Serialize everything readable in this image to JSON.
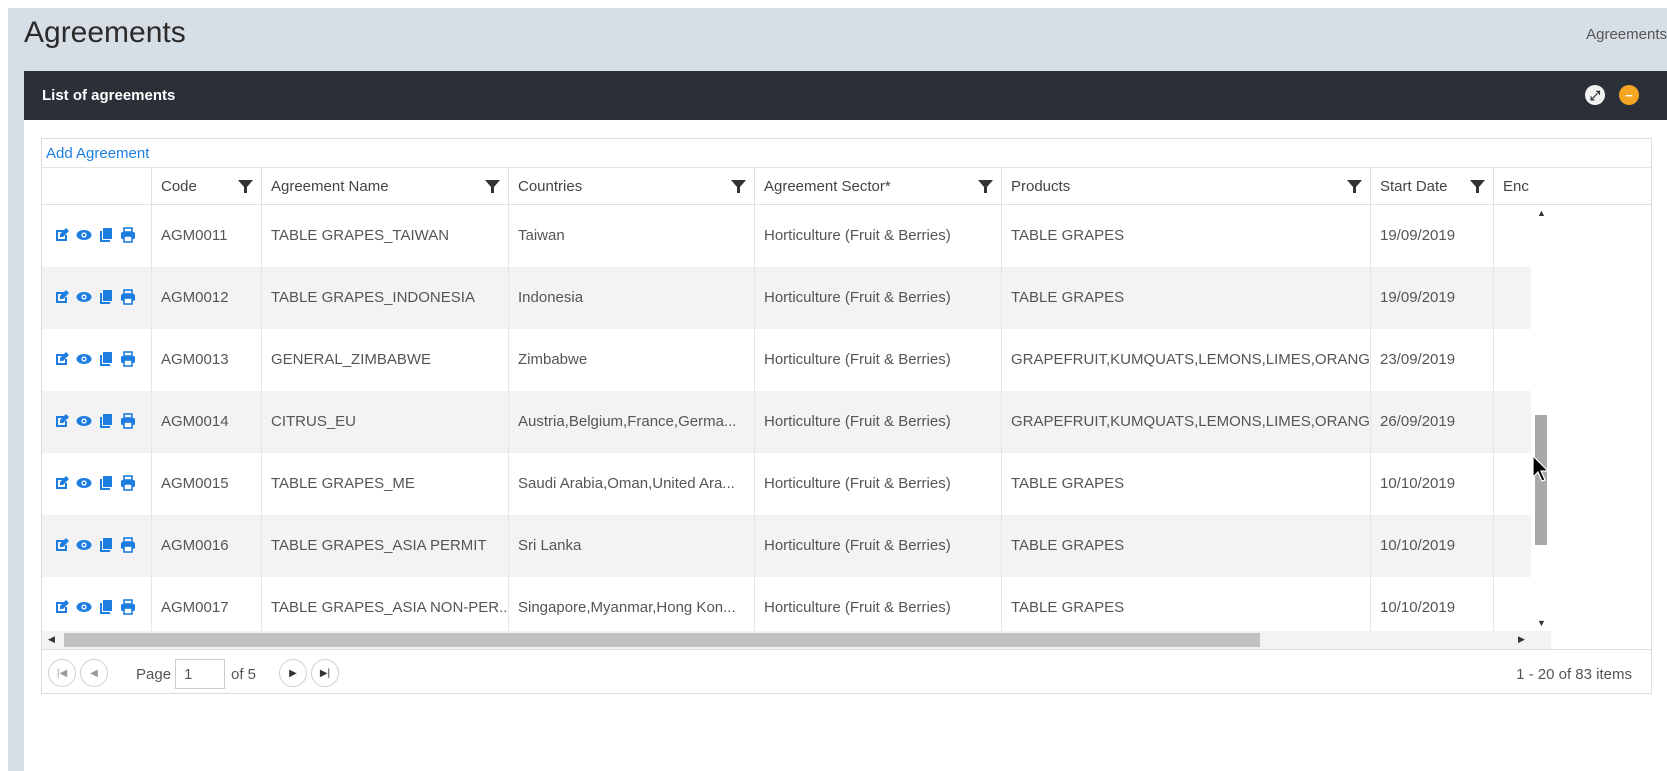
{
  "page": {
    "title": "Agreements",
    "breadcrumb": "Agreements"
  },
  "panel": {
    "title": "List of agreements"
  },
  "toolbar": {
    "add_label": "Add Agreement"
  },
  "columns": [
    "",
    "Code",
    "Agreement Name",
    "Countries",
    "Agreement Sector*",
    "Products",
    "Start Date",
    "Enc"
  ],
  "rows": [
    {
      "code": "AGM0011",
      "name": "TABLE GRAPES_TAIWAN",
      "countries": "Taiwan",
      "sector": "Horticulture (Fruit & Berries)",
      "products": "TABLE GRAPES",
      "start": "19/09/2019"
    },
    {
      "code": "AGM0012",
      "name": "TABLE GRAPES_INDONESIA",
      "countries": "Indonesia",
      "sector": "Horticulture (Fruit & Berries)",
      "products": "TABLE GRAPES",
      "start": "19/09/2019"
    },
    {
      "code": "AGM0013",
      "name": "GENERAL_ZIMBABWE",
      "countries": "Zimbabwe",
      "sector": "Horticulture (Fruit & Berries)",
      "products": "GRAPEFRUIT,KUMQUATS,LEMONS,LIMES,ORANG...",
      "start": "23/09/2019"
    },
    {
      "code": "AGM0014",
      "name": "CITRUS_EU",
      "countries": "Austria,Belgium,France,Germa...",
      "sector": "Horticulture (Fruit & Berries)",
      "products": "GRAPEFRUIT,KUMQUATS,LEMONS,LIMES,ORANG...",
      "start": "26/09/2019"
    },
    {
      "code": "AGM0015",
      "name": "TABLE GRAPES_ME",
      "countries": "Saudi Arabia,Oman,United Ara...",
      "sector": "Horticulture (Fruit & Berries)",
      "products": "TABLE GRAPES",
      "start": "10/10/2019"
    },
    {
      "code": "AGM0016",
      "name": "TABLE GRAPES_ASIA PERMIT",
      "countries": "Sri Lanka",
      "sector": "Horticulture (Fruit & Berries)",
      "products": "TABLE GRAPES",
      "start": "10/10/2019"
    },
    {
      "code": "AGM0017",
      "name": "TABLE GRAPES_ASIA NON-PER...",
      "countries": "Singapore,Myanmar,Hong Kon...",
      "sector": "Horticulture (Fruit & Berries)",
      "products": "TABLE GRAPES",
      "start": "10/10/2019"
    }
  ],
  "pager": {
    "page_label": "Page",
    "page_value": "1",
    "of_label": "of 5",
    "info": "1 - 20 of 83 items"
  },
  "colors": {
    "header_bg": "#2a2f38",
    "link": "#1e7de0",
    "action_icon": "#1e7de0",
    "collapse_btn": "#f5a623",
    "content_bg": "#d6dee6"
  },
  "icons": [
    "expand-icon",
    "collapse-icon",
    "filter-icon",
    "edit-icon",
    "view-icon",
    "copy-icon",
    "print-icon",
    "first-page-icon",
    "prev-page-icon",
    "next-page-icon",
    "last-page-icon",
    "mouse-cursor-icon"
  ]
}
